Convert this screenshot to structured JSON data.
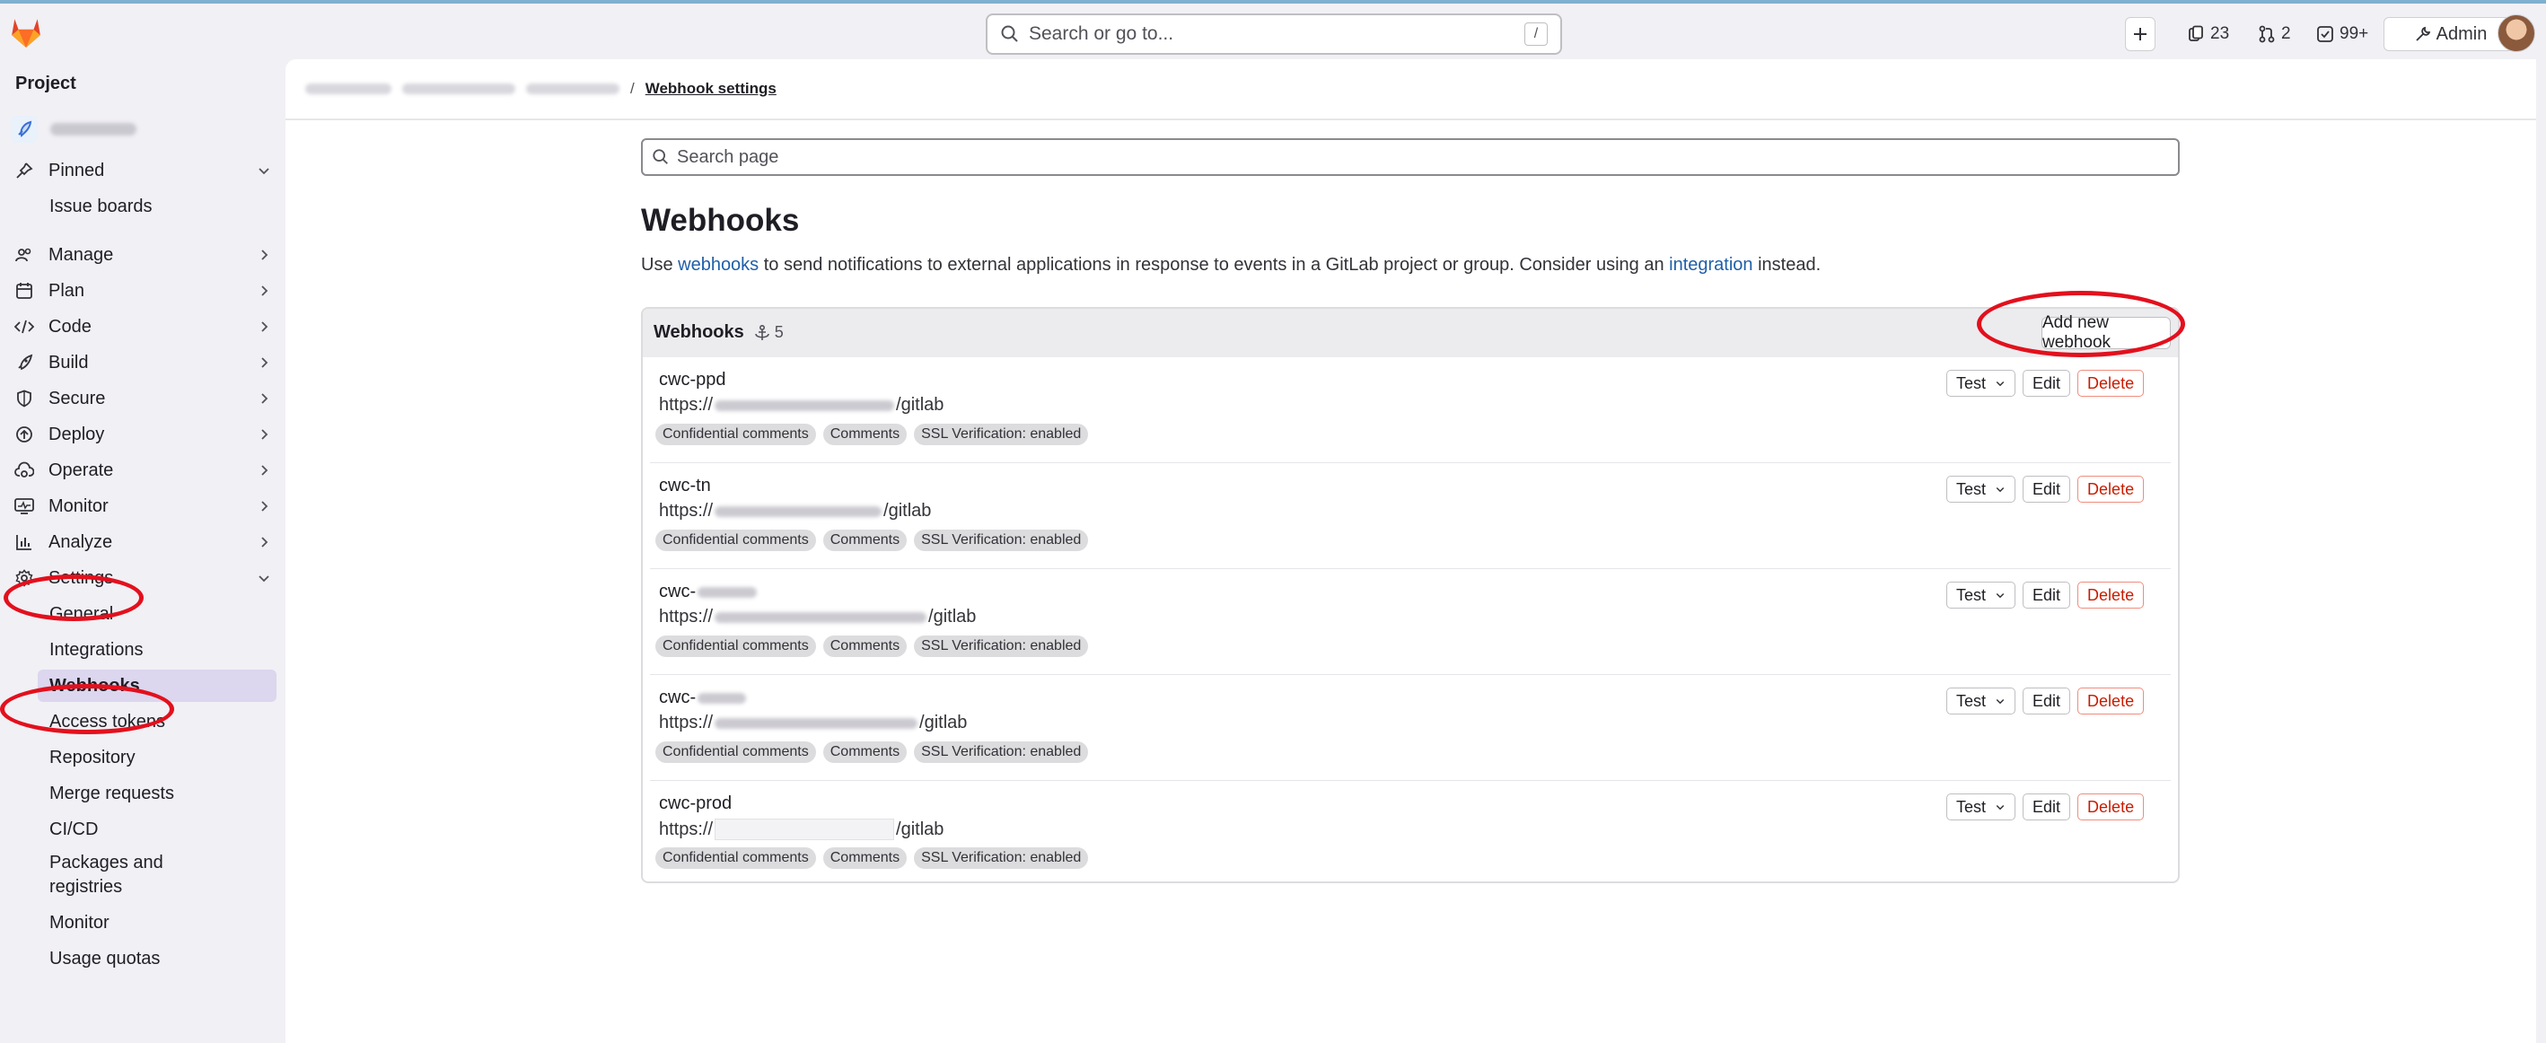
{
  "topbar": {
    "search_placeholder": "Search or go to...",
    "search_shortcut": "/",
    "issues_count": "23",
    "mr_count": "2",
    "todo_count": "99+",
    "admin_label": "Admin"
  },
  "sidebar": {
    "heading": "Project",
    "pinned_label": "Pinned",
    "pinned_items": [
      "Issue boards"
    ],
    "nav": [
      {
        "label": "Manage",
        "icon": "users-icon"
      },
      {
        "label": "Plan",
        "icon": "calendar-icon"
      },
      {
        "label": "Code",
        "icon": "code-icon"
      },
      {
        "label": "Build",
        "icon": "rocket-icon"
      },
      {
        "label": "Secure",
        "icon": "shield-icon"
      },
      {
        "label": "Deploy",
        "icon": "deploy-icon"
      },
      {
        "label": "Operate",
        "icon": "cloud-gear-icon"
      },
      {
        "label": "Monitor",
        "icon": "monitor-icon"
      },
      {
        "label": "Analyze",
        "icon": "chart-icon"
      },
      {
        "label": "Settings",
        "icon": "gear-icon"
      }
    ],
    "settings_items": [
      "General",
      "Integrations",
      "Webhooks",
      "Access tokens",
      "Repository",
      "Merge requests",
      "CI/CD",
      "Packages and registries",
      "Monitor",
      "Usage quotas"
    ]
  },
  "breadcrumb": {
    "separator": "/",
    "current": "Webhook settings"
  },
  "main": {
    "search_placeholder": "Search page",
    "title": "Webhooks",
    "desc_pre": "Use ",
    "desc_link1": "webhooks",
    "desc_mid": " to send notifications to external applications in response to events in a GitLab project or group. Consider using an ",
    "desc_link2": "integration",
    "desc_post": " instead."
  },
  "webhooks_card": {
    "title": "Webhooks",
    "count": "5",
    "add_button": "Add new webhook",
    "test_label": "Test",
    "edit_label": "Edit",
    "delete_label": "Delete",
    "hooks": [
      {
        "name": "cwc-ppd",
        "url_prefix": "https://",
        "url_suffix": "/gitlab",
        "badges": [
          "Confidential comments",
          "Comments",
          "SSL Verification: enabled"
        ]
      },
      {
        "name": "cwc-tn",
        "url_prefix": "https://",
        "url_suffix": "/gitlab",
        "badges": [
          "Confidential comments",
          "Comments",
          "SSL Verification: enabled"
        ]
      },
      {
        "name": "cwc-",
        "url_prefix": "https://",
        "url_suffix": "/gitlab",
        "badges": [
          "Confidential comments",
          "Comments",
          "SSL Verification: enabled"
        ]
      },
      {
        "name": "cwc-",
        "url_prefix": "https://",
        "url_suffix": "/gitlab",
        "badges": [
          "Confidential comments",
          "Comments",
          "SSL Verification: enabled"
        ]
      },
      {
        "name": "cwc-prod",
        "url_prefix": "https://",
        "url_suffix": "/gitlab",
        "badges": [
          "Confidential comments",
          "Comments",
          "SSL Verification: enabled"
        ]
      }
    ]
  },
  "colors": {
    "annotation": "#e3101d",
    "link": "#1f5fa9",
    "danger": "#c91c00",
    "active_nav": "#dcd6ee"
  }
}
